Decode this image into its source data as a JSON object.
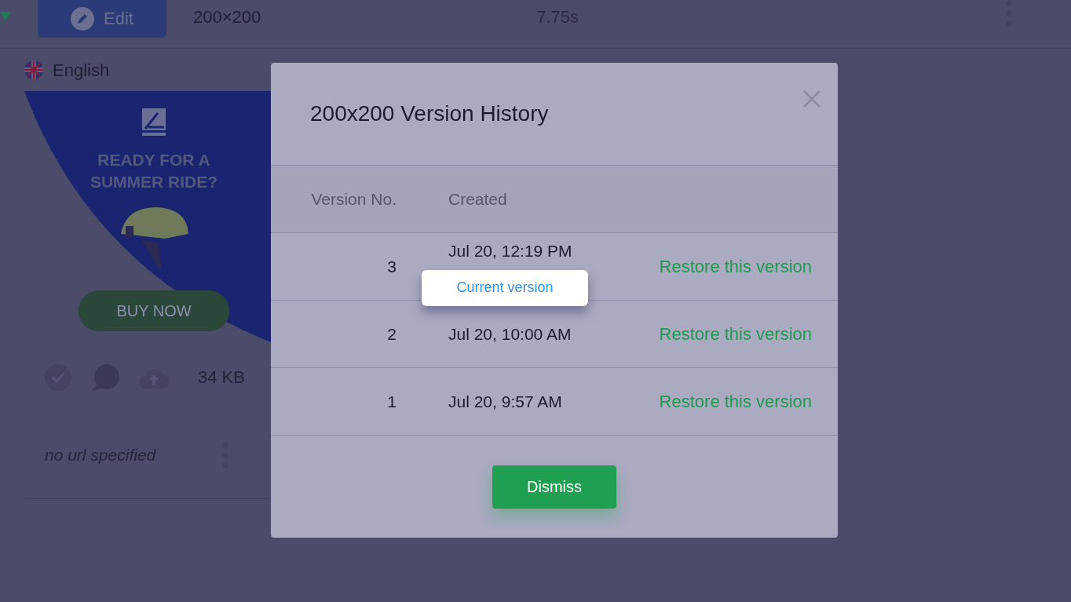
{
  "background": {
    "edit_button": "Edit",
    "size": "200×200",
    "duration": "7.75s",
    "language": "English",
    "ad": {
      "headline": "READY FOR A SUMMER RIDE?",
      "cta": "BUY NOW"
    },
    "file_size": "34 KB",
    "url": "no url specified"
  },
  "modal": {
    "title": "200x200 Version History",
    "columns": [
      "Version No.",
      "Created"
    ],
    "current_label": "Current version",
    "rows": [
      {
        "version": "3",
        "created": "Jul 20, 12:19 PM",
        "current": true,
        "action": "Restore this version"
      },
      {
        "version": "2",
        "created": "Jul 20, 10:00 AM",
        "current": false,
        "action": "Restore this version"
      },
      {
        "version": "1",
        "created": "Jul 20, 9:57 AM",
        "current": false,
        "action": "Restore this version"
      }
    ],
    "dismiss": "Dismiss"
  }
}
